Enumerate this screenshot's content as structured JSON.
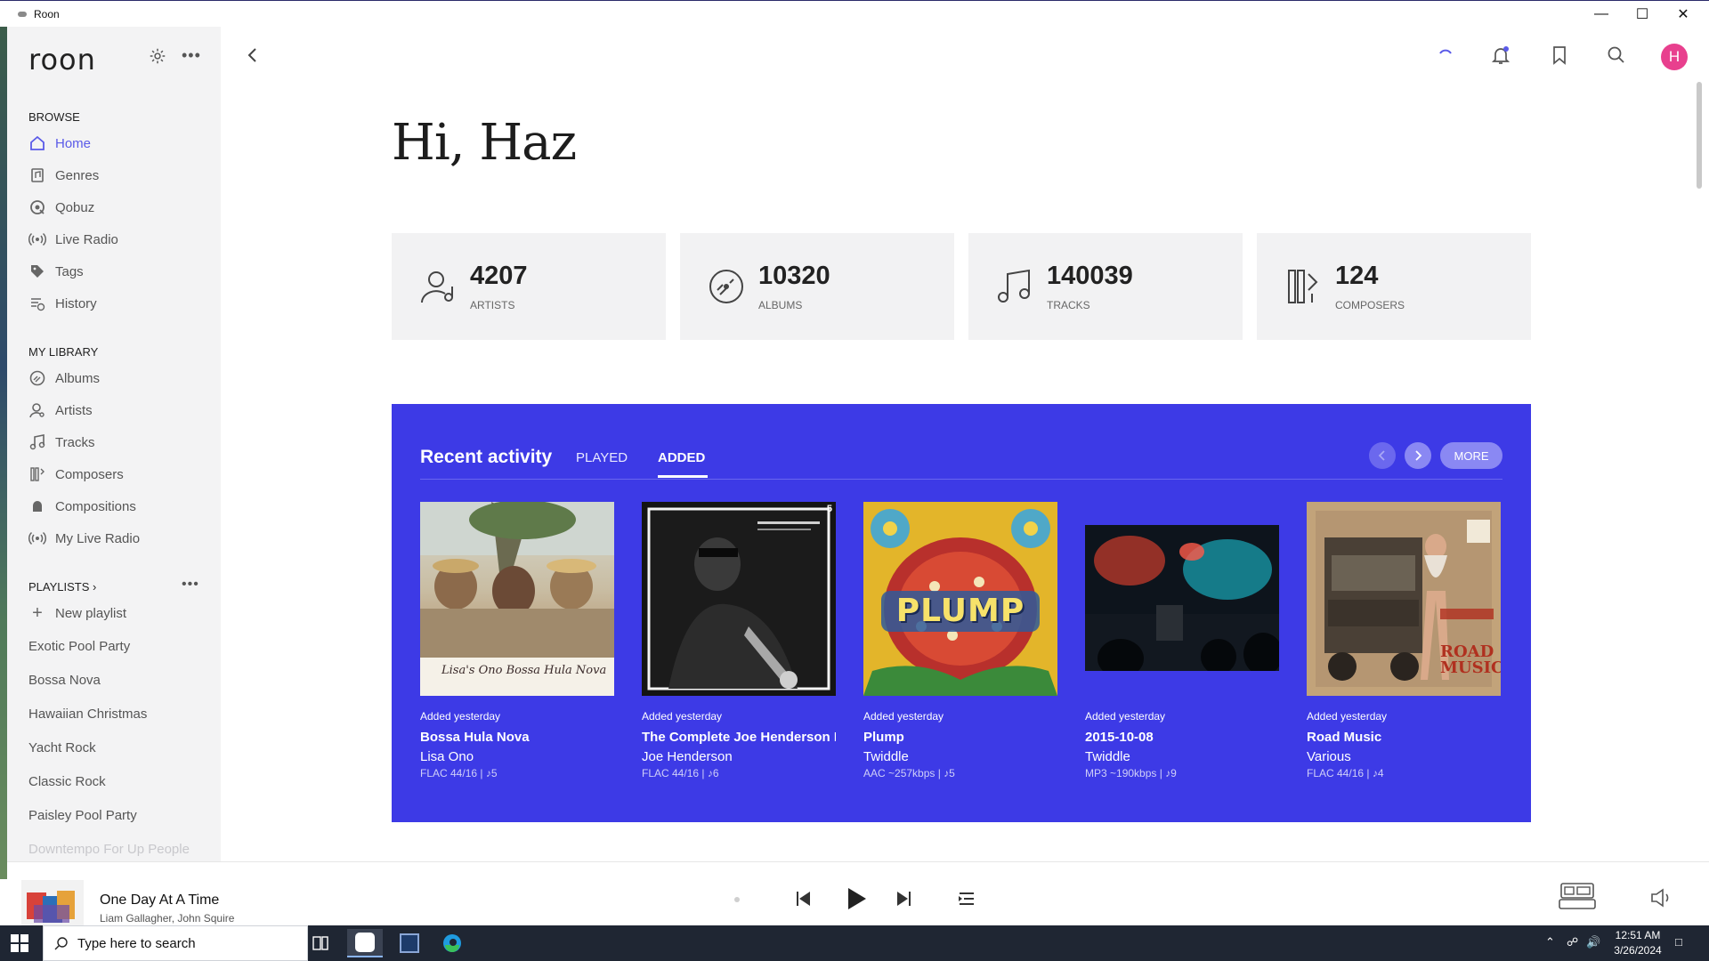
{
  "window": {
    "title": "Roon"
  },
  "sidebar": {
    "logo": "roon",
    "browse_title": "BROWSE",
    "browse": [
      {
        "label": "Home",
        "icon": "home-icon",
        "active": true
      },
      {
        "label": "Genres",
        "icon": "genres-icon"
      },
      {
        "label": "Qobuz",
        "icon": "qobuz-icon"
      },
      {
        "label": "Live Radio",
        "icon": "radio-icon"
      },
      {
        "label": "Tags",
        "icon": "tag-icon"
      },
      {
        "label": "History",
        "icon": "history-icon"
      }
    ],
    "library_title": "MY LIBRARY",
    "library": [
      {
        "label": "Albums",
        "icon": "album-icon"
      },
      {
        "label": "Artists",
        "icon": "artist-icon"
      },
      {
        "label": "Tracks",
        "icon": "track-icon"
      },
      {
        "label": "Composers",
        "icon": "composer-icon"
      },
      {
        "label": "Compositions",
        "icon": "composition-icon"
      },
      {
        "label": "My Live Radio",
        "icon": "radio-icon"
      }
    ],
    "playlists_title": "PLAYLISTS",
    "new_playlist": "New playlist",
    "playlists": [
      "Exotic Pool Party",
      "Bossa Nova",
      "Hawaiian Christmas",
      "Yacht Rock",
      "Classic Rock",
      "Paisley Pool Party",
      "Downtempo For Up People"
    ]
  },
  "greeting": "Hi, Haz",
  "avatar_initial": "H",
  "stats": [
    {
      "value": "4207",
      "label": "ARTISTS",
      "icon": "artist-icon"
    },
    {
      "value": "10320",
      "label": "ALBUMS",
      "icon": "album-icon"
    },
    {
      "value": "140039",
      "label": "TRACKS",
      "icon": "track-icon"
    },
    {
      "value": "124",
      "label": "COMPOSERS",
      "icon": "composer-icon"
    }
  ],
  "recent": {
    "title": "Recent activity",
    "tabs": [
      "PLAYED",
      "ADDED"
    ],
    "active_tab": "ADDED",
    "more_label": "MORE",
    "albums": [
      {
        "added": "Added yesterday",
        "title": "Bossa Hula Nova",
        "artist": "Lisa Ono",
        "format": "FLAC 44/16 | ♪5",
        "cover_text": "Lisa's Ono Bossa Hula Nova"
      },
      {
        "added": "Added yesterday",
        "title": "The Complete Joe Henderson Blue Note Studio Sessions",
        "artist": "Joe Henderson",
        "format": "FLAC 44/16 | ♪6",
        "cover_badge": "5"
      },
      {
        "added": "Added yesterday",
        "title": "Plump",
        "artist": "Twiddle",
        "format": "AAC ~257kbps | ♪5",
        "cover_text": "PLUMP"
      },
      {
        "added": "Added yesterday",
        "title": "2015-10-08",
        "artist": "Twiddle",
        "format": "MP3 ~190kbps | ♪9"
      },
      {
        "added": "Added yesterday",
        "title": "Road Music",
        "artist": "Various",
        "format": "FLAC 44/16 | ♪4",
        "cover_text": "ROAD MUSIC"
      }
    ]
  },
  "player": {
    "title": "One Day At A Time",
    "artist": "Liam Gallagher, John Squire"
  },
  "taskbar": {
    "search_placeholder": "Type here to search",
    "time": "12:51 AM",
    "date": "3/26/2024"
  },
  "colors": {
    "accent": "#5a5ae8",
    "recent_bg": "#3d3ae6",
    "avatar": "#e8408e"
  }
}
